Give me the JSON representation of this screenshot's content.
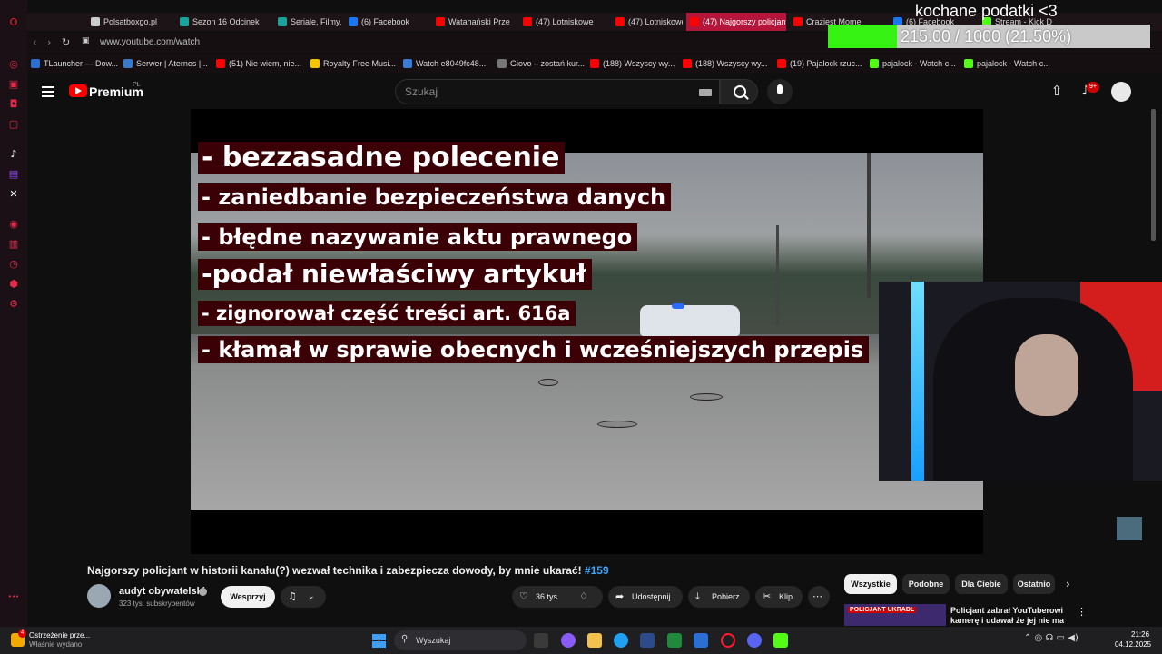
{
  "browser": {
    "tabs": [
      {
        "label": "Polsatboxgo.pl",
        "icon": "globe-icon",
        "color": "#cccccc"
      },
      {
        "label": "Sezon 16 Odcinek",
        "icon": "p-icon",
        "color": "#1aa39a"
      },
      {
        "label": "Seriale, Filmy, Pr",
        "icon": "p-icon",
        "color": "#1aa39a"
      },
      {
        "label": "(6) Facebook",
        "icon": "facebook-icon",
        "color": "#1877f2"
      },
      {
        "label": "Watahański Prze",
        "icon": "youtube-icon",
        "color": "#ff0000"
      },
      {
        "label": "(47) Lotniskowe",
        "icon": "youtube-icon",
        "color": "#ff0000"
      },
      {
        "label": "(47) Lotniskowe",
        "icon": "youtube-icon",
        "color": "#ff0000"
      },
      {
        "label": "(47) Najgorszy policjant",
        "icon": "youtube-icon",
        "color": "#ff0000",
        "active": true
      },
      {
        "label": "Craziest Mome",
        "icon": "youtube-icon",
        "color": "#ff0000"
      },
      {
        "label": "(6) Facebook",
        "icon": "facebook-icon",
        "color": "#1877f2"
      },
      {
        "label": "Stream - Kick D",
        "icon": "kick-icon",
        "color": "#53fc18"
      }
    ],
    "url": "www.youtube.com/watch",
    "bookmarks": [
      {
        "label": "TLauncher — Dow...",
        "color": "#2d6fd1"
      },
      {
        "label": "Serwer | Aternos |...",
        "color": "#3a78c9"
      },
      {
        "label": "(51) Nie wiem, nie...",
        "color": "#ff0000"
      },
      {
        "label": "Royalty Free Musi...",
        "color": "#f5c400"
      },
      {
        "label": "Watch e8049fc48...",
        "color": "#3b7cd7"
      },
      {
        "label": "Giovo – zostań kur...",
        "color": "#777777"
      },
      {
        "label": "(188) Wszyscy wy...",
        "color": "#ff0000"
      },
      {
        "label": "(188) Wszyscy wy...",
        "color": "#ff0000"
      },
      {
        "label": "(19) Pajalock rzuc...",
        "color": "#ff0000"
      },
      {
        "label": "pajalock - Watch c...",
        "color": "#53fc18"
      },
      {
        "label": "pajalock - Watch c...",
        "color": "#53fc18"
      }
    ]
  },
  "overlay": {
    "goal_title": "kochane podatki <3",
    "goal_text": "215.00 / 1000 (21.50%)",
    "goal_progress": 0.215,
    "accent": "#37f313"
  },
  "youtube": {
    "brand": "Premium",
    "region": "PL",
    "search_placeholder": "Szukaj",
    "notifications": "9+"
  },
  "video": {
    "captions": [
      "- bezzasadne polecenie",
      "- zaniedbanie bezpieczeństwa danych",
      "- błędne nazywanie aktu prawnego",
      "-podał niewłaściwy artykuł",
      "- zignorował część treści art. 616a",
      "- kłamał w sprawie obecnych i wcześniejszych przepis"
    ],
    "title": "Najgorszy policjant w historii kanału(?) wezwał technika i zabezpiecza dowody, by mnie ukarać!",
    "tag": "#159",
    "channel_name": "audyt obywatelski",
    "subscribers": "323 tys. subskrybentów",
    "support_label": "Wesprzyj",
    "likes": "36 tys.",
    "share_label": "Udostępnij",
    "download_label": "Pobierz",
    "clip_label": "Klip"
  },
  "sidebar_chips": [
    "Wszystkie",
    "Podobne",
    "Dla Ciebie",
    "Ostatnio"
  ],
  "recommendation": {
    "title": "Policjant zabrał YouTuberowi kamerę i udawał że jej nie ma",
    "badge": "POLICJANT UKRADŁ"
  },
  "taskbar": {
    "warning_title": "Ostrzeżenie prze...",
    "warning_sub": "Właśnie wydano",
    "warning_count": "4",
    "search_label": "Wyszukaj",
    "time": "21:26",
    "date": "04.12.2025"
  }
}
